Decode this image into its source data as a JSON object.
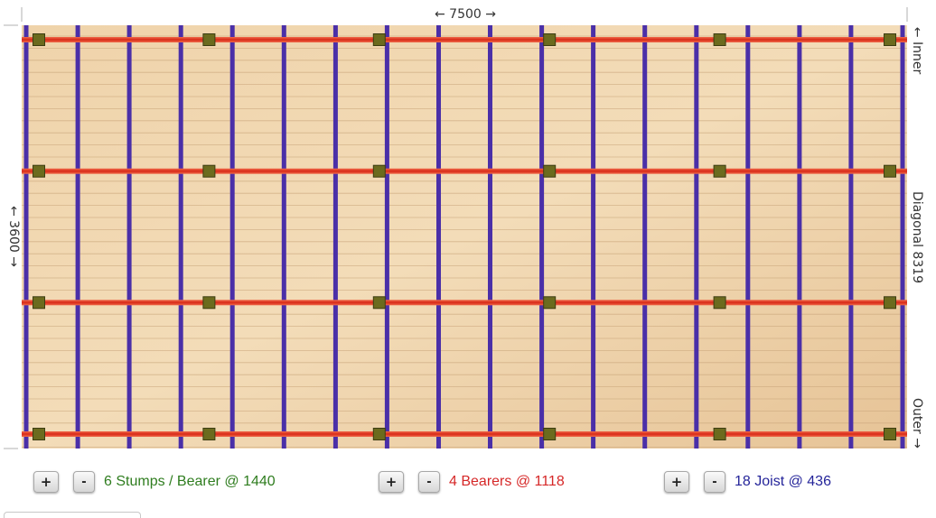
{
  "deck": {
    "width_mm": 7500,
    "depth_mm": 3600,
    "diagonal_mm": 8319,
    "width_label": "← 7500 →",
    "depth_label": "← 3600 →",
    "side_labels": {
      "inner": "← Inner",
      "diagonal": "Diagonal  8319",
      "outer": "Outer →"
    }
  },
  "framing": {
    "stumps_per_bearer": 6,
    "stump_spacing_mm": 1440,
    "bearer_count": 4,
    "bearer_spacing_mm": 1118,
    "joist_count": 18,
    "joist_spacing_mm": 436
  },
  "colors": {
    "bearer": "#e0301e",
    "joist": "#4a2fa8",
    "stump": "#6b6b1e",
    "stumps_text": "#2f7d1f",
    "bearers_text": "#d62828",
    "joists_text": "#25259a",
    "board_light": "#f0d2a6",
    "board_dark": "#e2bc8a"
  },
  "controls": {
    "stumps": {
      "plus": "+",
      "minus": "-",
      "text": "6 Stumps / Bearer @ 1440"
    },
    "bearers": {
      "plus": "+",
      "minus": "-",
      "text": "4 Bearers @ 1118"
    },
    "joists": {
      "plus": "+",
      "minus": "-",
      "text": "18 Joist @ 436"
    }
  }
}
